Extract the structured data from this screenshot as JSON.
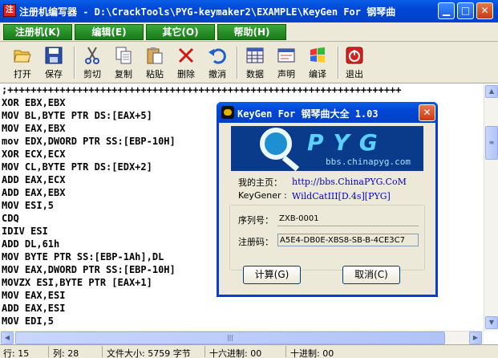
{
  "window": {
    "title": "注册机编写器 - D:\\CrackTools\\PYG-keymaker2\\EXAMPLE\\KeyGen For 钢琴曲",
    "min": "▁",
    "max": "□",
    "close": "✕",
    "app_icon": "注"
  },
  "menu": [
    {
      "label": "注册机(K)"
    },
    {
      "label": "编辑(E)"
    },
    {
      "label": "其它(O)"
    },
    {
      "label": "帮助(H)"
    }
  ],
  "toolbar": [
    {
      "label": "打开",
      "icon": "open-folder-icon"
    },
    {
      "label": "保存",
      "icon": "save-disk-icon"
    },
    {
      "label": "剪切",
      "icon": "cut-scissors-icon"
    },
    {
      "label": "复制",
      "icon": "copy-icon"
    },
    {
      "label": "粘贴",
      "icon": "paste-icon"
    },
    {
      "label": "删除",
      "icon": "delete-x-icon"
    },
    {
      "label": "撤消",
      "icon": "undo-icon"
    },
    {
      "label": "数据",
      "icon": "data-grid-icon"
    },
    {
      "label": "声明",
      "icon": "declaration-icon"
    },
    {
      "label": "编译",
      "icon": "compile-icon"
    },
    {
      "label": "退出",
      "icon": "exit-icon"
    }
  ],
  "code_lines": [
    ";++++++++++++++++++++++++++++++++++++++++++++++++++++++++++++++++++++",
    "XOR EBX,EBX",
    "MOV BL,BYTE PTR DS:[EAX+5]",
    "MOV EAX,EBX",
    "mov EDX,DWORD PTR SS:[EBP-10H]",
    "XOR ECX,ECX",
    "MOV CL,BYTE PTR DS:[EDX+2]",
    "ADD EAX,ECX",
    "ADD EAX,EBX",
    "MOV ESI,5",
    "CDQ",
    "IDIV ESI",
    "ADD DL,61h",
    "MOV BYTE PTR SS:[EBP-1Ah],DL",
    "MOV EAX,DWORD PTR SS:[EBP-10H]",
    "MOVZX ESI,BYTE PTR [EAX+1]",
    "MOV EAX,ESI",
    "ADD EAX,ESI",
    "MOV EDI,5"
  ],
  "scrollbars": {
    "up": "▲",
    "down": "▼",
    "left": "◀",
    "right": "▶",
    "thumb": "≡",
    "h_thumb": "|||"
  },
  "status": {
    "row_label": "行: 15",
    "col_label": "列: 28",
    "size_label": "文件大小: 5759 字节",
    "hex_label": "十六进制: 00",
    "dec_label": "十进制: 00"
  },
  "dialog": {
    "title": "KeyGen For 钢琴曲大全 1.03",
    "close": "✕",
    "banner_text": "PYG",
    "banner_url": "bbs.chinapyg.com",
    "homepage_label": "我的主页：",
    "homepage_value": "http://bbs.ChinaPYG.CoM",
    "keygener_label": "KeyGener :",
    "keygener_value": "WildCatIII[D.4s][PYG]",
    "serial_label": "序列号：",
    "serial_value": "ZXB-0001",
    "regcode_label": "注册码：",
    "regcode_value": "A5E4-DB0E-XBS8-SB-B-4CE3C7",
    "calc_button": "计算(G)",
    "cancel_button": "取消(C)"
  }
}
